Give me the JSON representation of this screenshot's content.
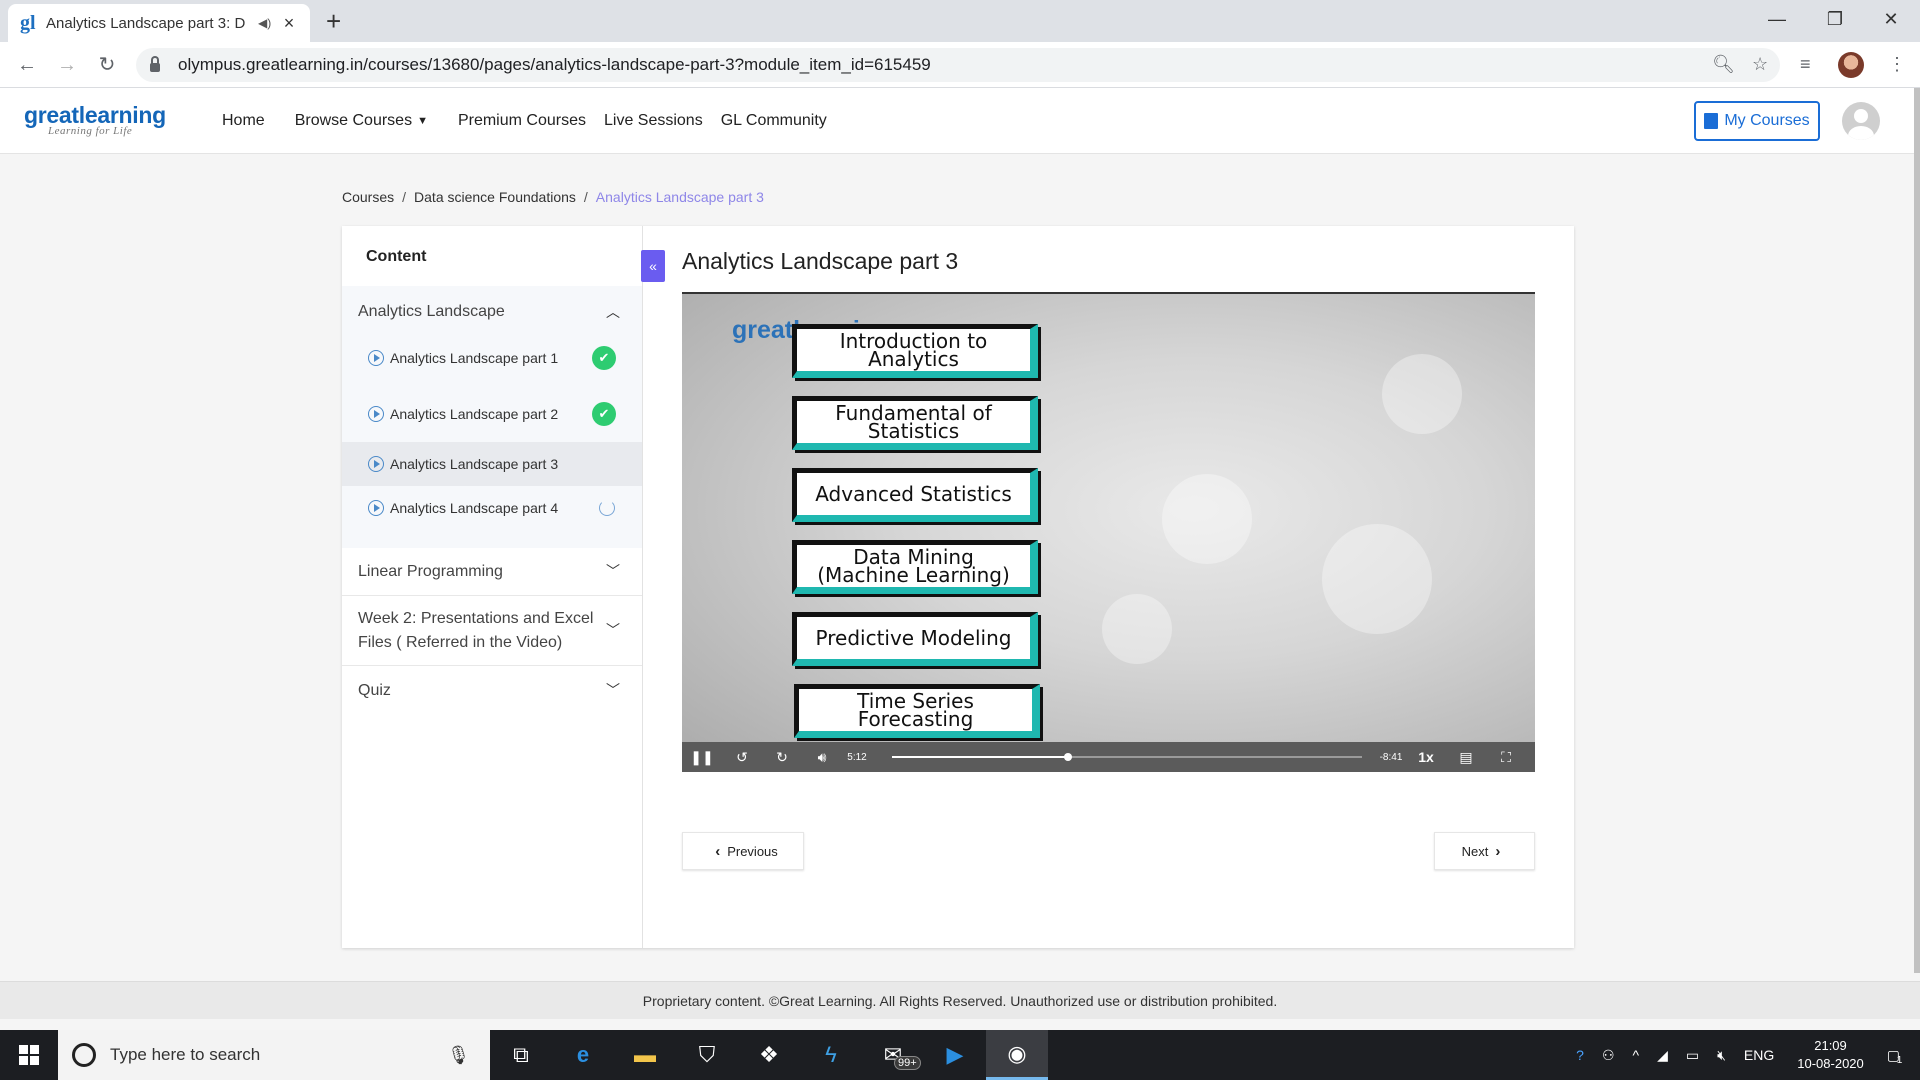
{
  "browser": {
    "tab_title": "Analytics Landscape part 3: D",
    "tab_favicon": "gl",
    "url": "olympus.greatlearning.in/courses/13680/pages/analytics-landscape-part-3?module_item_id=615459"
  },
  "site": {
    "logo_brand_a": "great",
    "logo_brand_b": "learning",
    "logo_tagline": "Learning for Life",
    "nav": {
      "home": "Home",
      "browse": "Browse Courses",
      "premium": "Premium Courses",
      "live": "Live Sessions",
      "community": "GL Community"
    },
    "my_courses": "My Courses"
  },
  "breadcrumb": {
    "items": [
      "Courses",
      "Data science Foundations"
    ],
    "current": "Analytics Landscape part 3",
    "separator": "/"
  },
  "sidebar": {
    "title": "Content",
    "collapse_glyph": "«",
    "modules": [
      {
        "title": "Analytics Landscape",
        "expanded": true,
        "lessons": [
          {
            "label": "Analytics Landscape part 1",
            "status": "completed"
          },
          {
            "label": "Analytics Landscape part 2",
            "status": "completed"
          },
          {
            "label": "Analytics Landscape part 3",
            "status": "current"
          },
          {
            "label": "Analytics Landscape part 4",
            "status": "in-progress"
          }
        ]
      },
      {
        "title": "Linear Programming",
        "expanded": false
      },
      {
        "title_line1": "Week 2: Presentations and Excel",
        "title_line2": "Files ( Referred in the Video)",
        "expanded": false
      },
      {
        "title": "Quiz",
        "expanded": false
      }
    ]
  },
  "lesson": {
    "title": "Analytics Landscape part 3",
    "video": {
      "watermark_a": "great",
      "watermark_b": "learning",
      "slides": [
        "Introduction to Analytics",
        "Fundamental of Statistics",
        "Advanced Statistics",
        "Data Mining",
        "(Machine Learning)",
        "Predictive Modeling",
        "Time Series Forecasting"
      ],
      "elapsed": "5:12",
      "remaining": "-8:41",
      "speed": "1x",
      "progress_fraction": 0.375
    },
    "prev_label": "Previous",
    "next_label": "Next"
  },
  "footer": {
    "text": "Proprietary content. ©Great Learning. All Rights Reserved. Unauthorized use or distribution prohibited."
  },
  "taskbar": {
    "search_placeholder": "Type here to search",
    "mail_badge": "99+",
    "lang": "ENG",
    "time": "21:09",
    "date": "10-08-2020",
    "notif_count": "1"
  },
  "colors": {
    "accent": "#6a5cf0",
    "brand": "#1466b8",
    "success": "#2ecc71",
    "breadcrumb_current": "#8e86e8"
  }
}
